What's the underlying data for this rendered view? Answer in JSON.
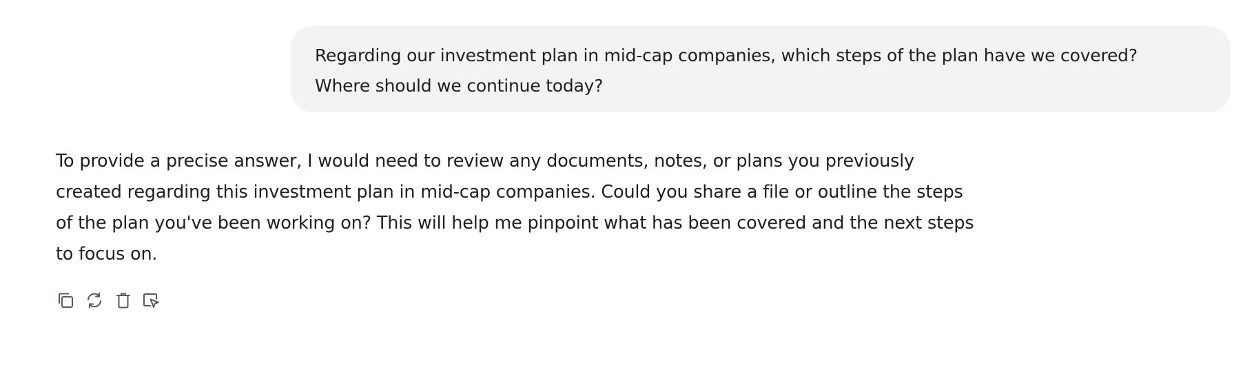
{
  "conversation": {
    "user_message": {
      "lines": [
        "Regarding our investment plan in mid-cap companies, which steps of the plan have we covered?",
        "Where should we continue today?"
      ]
    },
    "assistant_message": {
      "lines": [
        "To provide a precise answer, I would need to review any documents, notes, or plans you previously",
        "created regarding this investment plan in mid-cap companies. Could you share a file or outline the steps",
        "of the plan you've been working on? This will help me pinpoint what has been covered and the next steps",
        "to focus on."
      ]
    },
    "actions": [
      {
        "icon": "copy-icon"
      },
      {
        "icon": "regenerate-icon"
      },
      {
        "icon": "delete-icon"
      },
      {
        "icon": "select-icon"
      }
    ]
  },
  "colors": {
    "user_bubble_bg": "#f3f3f3",
    "text": "#1f1f1f",
    "icon": "#555a60"
  }
}
